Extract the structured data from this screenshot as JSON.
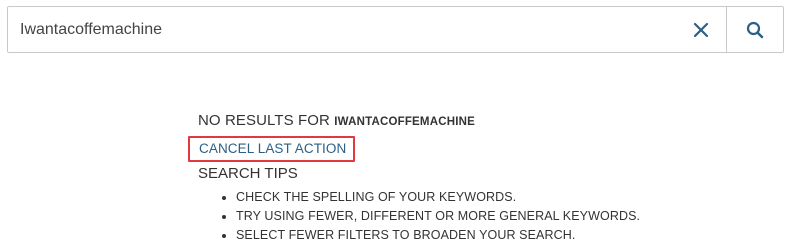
{
  "search": {
    "value": "Iwantacoffemachine",
    "clear_icon": "close-icon",
    "search_icon": "search-icon"
  },
  "results": {
    "no_results_prefix": "NO RESULTS FOR",
    "query": "IWANTACOFFEMACHINE",
    "cancel_label": "CANCEL LAST ACTION",
    "tips_heading": "SEARCH TIPS",
    "tips": [
      "CHECK THE SPELLING OF YOUR KEYWORDS.",
      "TRY USING FEWER, DIFFERENT OR MORE GENERAL KEYWORDS.",
      "SELECT FEWER FILTERS TO BROADEN YOUR SEARCH."
    ]
  },
  "colors": {
    "accent": "#2a5f86",
    "highlight_border": "#e0393e",
    "text": "#333333"
  }
}
